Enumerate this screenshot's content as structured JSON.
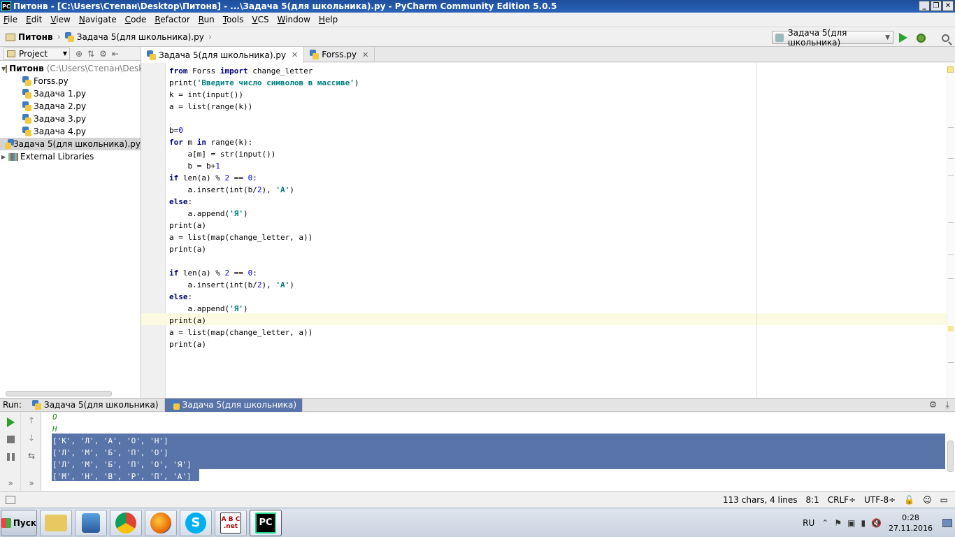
{
  "window": {
    "title": "Питонв - [C:\\Users\\Степан\\Desktop\\Питонв] - ...\\Задача 5(для школьника).py - PyCharm Community Edition 5.0.5",
    "app_icon": "PC"
  },
  "menu": [
    "File",
    "Edit",
    "View",
    "Navigate",
    "Code",
    "Refactor",
    "Run",
    "Tools",
    "VCS",
    "Window",
    "Help"
  ],
  "breadcrumb": {
    "project": "Питонв",
    "file": "Задача 5(для школьника).py"
  },
  "run_config": {
    "label": "Задача 5(для школьника)"
  },
  "project_panel": {
    "view_label": "Project",
    "root": {
      "name": "Питонв",
      "path": "(C:\\Users\\Степан\\Desktop"
    },
    "files": [
      "Forss.py",
      "Задача 1.py",
      "Задача 2.py",
      "Задача 3.py",
      "Задача 4.py",
      "Задача 5(для школьника).py"
    ],
    "selected_file": "Задача 5(для школьника).py",
    "external_libraries": "External Libraries"
  },
  "editor_tabs": [
    {
      "label": "Задача 5(для школьника).py",
      "active": true
    },
    {
      "label": "Forss.py",
      "active": false
    }
  ],
  "code": {
    "l1": [
      "from",
      " Forss ",
      "import",
      " change_letter"
    ],
    "l2": [
      "print(",
      "'Введите число символов в массиве'",
      ")"
    ],
    "l3": "k = int(input())",
    "l4": "a = list(range(k))",
    "l5": "",
    "l6": [
      "b=",
      "0"
    ],
    "l7": [
      "for",
      " m ",
      "in",
      " range(k):"
    ],
    "l8": "    a[m] = str(input())",
    "l9": [
      "    b = b+",
      "1"
    ],
    "l10": [
      "if",
      " len(a) % ",
      "2",
      " == ",
      "0",
      ":"
    ],
    "l11": [
      "    a.insert(int(b/",
      "2",
      "), ",
      "'А'",
      ")"
    ],
    "l12": [
      "else",
      ":"
    ],
    "l13": [
      "    a.append(",
      "'Я'",
      ")"
    ],
    "l14": "print(a)",
    "l15": "a = list(map(change_letter, a))",
    "l16": "print(a)",
    "l17": "",
    "l18": [
      "if",
      " len(a) % ",
      "2",
      " == ",
      "0",
      ":"
    ],
    "l19": [
      "    a.insert(int(b/",
      "2",
      "), ",
      "'А'",
      ")"
    ],
    "l20": [
      "else",
      ":"
    ],
    "l21": [
      "    a.append(",
      "'Я'",
      ")"
    ],
    "l22": "print(a)",
    "l23": "a = list(map(change_letter, a))",
    "l24": "print(a)"
  },
  "run_panel": {
    "label": "Run:",
    "tabs": [
      {
        "label": "Задача 5(для школьника)",
        "active": false
      },
      {
        "label": "Задача 5(для школьника)",
        "active": true
      }
    ],
    "output": {
      "input1": "О",
      "input2": "Н",
      "out1": "['К', 'Л', 'А', 'О', 'Н']",
      "out2": "['Л', 'М', 'Б', 'П', 'О']",
      "out3": "['Л', 'М', 'Б', 'П', 'О', 'Я']",
      "out4": "['М', 'Н', 'В', 'Р', 'П', 'А']"
    }
  },
  "status_bar": {
    "chars": "113 chars, 4 lines",
    "position": "8:1",
    "line_sep": "CRLF÷",
    "encoding": "UTF-8÷"
  },
  "taskbar": {
    "start": "Пуск",
    "abc_label": "A B C .net",
    "pc_label": "PC",
    "lang": "RU",
    "time": "0:28",
    "date": "27.11.2016"
  }
}
